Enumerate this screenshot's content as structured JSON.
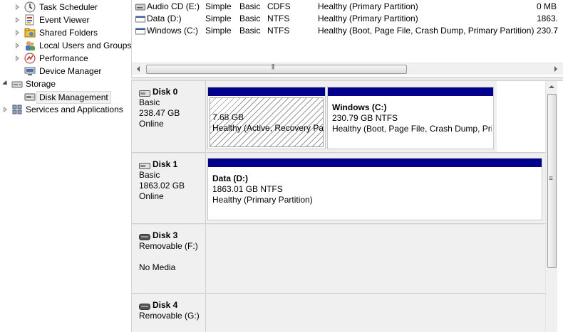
{
  "tree": {
    "items": [
      {
        "label": "Task Scheduler",
        "icon": "task-scheduler-icon",
        "expander": "right"
      },
      {
        "label": "Event Viewer",
        "icon": "event-viewer-icon",
        "expander": "right"
      },
      {
        "label": "Shared Folders",
        "icon": "shared-folders-icon",
        "expander": "right"
      },
      {
        "label": "Local Users and Groups",
        "icon": "users-icon",
        "expander": "right"
      },
      {
        "label": "Performance",
        "icon": "performance-icon",
        "expander": "right"
      },
      {
        "label": "Device Manager",
        "icon": "device-manager-icon",
        "expander": "none"
      },
      {
        "label": "Storage",
        "icon": "storage-icon",
        "expander": "down"
      },
      {
        "label": "Disk Management",
        "icon": "disk-management-icon",
        "expander": "none",
        "selected": true
      },
      {
        "label": "Services and Applications",
        "icon": "services-icon",
        "expander": "right"
      }
    ]
  },
  "volumes": [
    {
      "name": "Audio CD (E:)",
      "layout": "Simple",
      "type": "Basic",
      "fs": "CDFS",
      "status": "Healthy (Primary Partition)",
      "capacity": "0 MB",
      "icon": "cd-drive-icon"
    },
    {
      "name": "Data (D:)",
      "layout": "Simple",
      "type": "Basic",
      "fs": "NTFS",
      "status": "Healthy (Primary Partition)",
      "capacity": "1863.",
      "icon": "volume-icon"
    },
    {
      "name": "Windows (C:)",
      "layout": "Simple",
      "type": "Basic",
      "fs": "NTFS",
      "status": "Healthy (Boot, Page File, Crash Dump, Primary Partition)",
      "capacity": "230.7",
      "icon": "volume-icon"
    }
  ],
  "disks": [
    {
      "name": "Disk 0",
      "type": "Basic",
      "size": "238.47 GB",
      "status": "Online",
      "partitions": [
        {
          "title": "",
          "size": "7.68 GB",
          "status": "Healthy (Active, Recovery Pa"
        },
        {
          "title": "Windows  (C:)",
          "size": "230.79 GB NTFS",
          "status": "Healthy (Boot, Page File, Crash Dump, Pri"
        }
      ]
    },
    {
      "name": "Disk 1",
      "type": "Basic",
      "size": "1863.02 GB",
      "status": "Online",
      "partitions": [
        {
          "title": "Data  (D:)",
          "size": "1863.01 GB NTFS",
          "status": "Healthy (Primary Partition)"
        }
      ]
    },
    {
      "name": "Disk 3",
      "type": "Removable (F:)",
      "extra": "No Media"
    },
    {
      "name": "Disk 4",
      "type": "Removable (G:)"
    }
  ],
  "colors": {
    "partition_bar": "#00008b",
    "selection_bg": "#f1f1f1"
  }
}
